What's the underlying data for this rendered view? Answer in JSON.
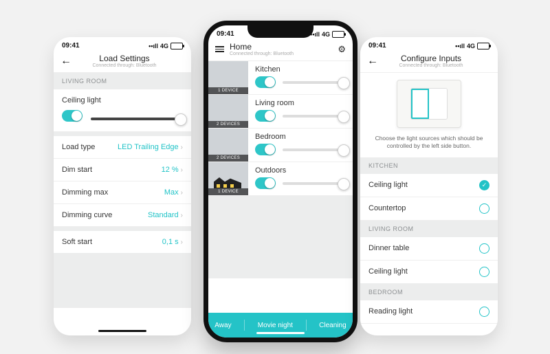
{
  "status": {
    "time": "09:41",
    "net": "4G",
    "sig": "••ıll"
  },
  "left": {
    "title": "Load Settings",
    "subtitle": "Connected through: Bluetooth",
    "section": "LIVING ROOM",
    "device": "Ceiling light",
    "rows": [
      {
        "label": "Load type",
        "value": "LED Trailing Edge"
      },
      {
        "label": "Dim start",
        "value": "12 %"
      },
      {
        "label": "Dimming max",
        "value": "Max"
      },
      {
        "label": "Dimming curve",
        "value": "Standard"
      },
      {
        "label": "Soft start",
        "value": "0,1 s"
      }
    ]
  },
  "center": {
    "title": "Home",
    "subtitle": "Connected through: Bluetooth",
    "rooms": [
      {
        "name": "Kitchen",
        "devices": "1 DEVICE"
      },
      {
        "name": "Living room",
        "devices": "2 DEVICES"
      },
      {
        "name": "Bedroom",
        "devices": "2 DEVICES"
      },
      {
        "name": "Outdoors",
        "devices": "1 DEVICE"
      }
    ],
    "scenes": [
      "Away",
      "Movie night",
      "Cleaning"
    ]
  },
  "right": {
    "title": "Configure Inputs",
    "subtitle": "Connected through: Bluetooth",
    "desc": "Choose the light sources which should be controlled by the left side button.",
    "groups": [
      {
        "title": "KITCHEN",
        "items": [
          {
            "name": "Ceiling light",
            "on": true
          },
          {
            "name": "Countertop",
            "on": false
          }
        ]
      },
      {
        "title": "LIVING ROOM",
        "items": [
          {
            "name": "Dinner table",
            "on": false
          },
          {
            "name": "Ceiling light",
            "on": false
          }
        ]
      },
      {
        "title": "BEDROOM",
        "items": [
          {
            "name": "Reading light",
            "on": false
          }
        ]
      }
    ]
  }
}
